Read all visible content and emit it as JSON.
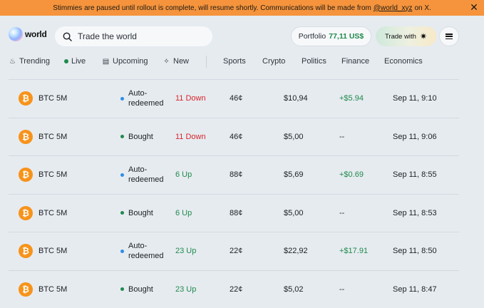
{
  "banner": {
    "message_before": "Stimmies are paused until rollout is complete, will resume shortly. Communications will be made from",
    "handle": "@world_xyz",
    "message_after": "on X.",
    "close_icon": "close-icon",
    "color": "#f5943d"
  },
  "header": {
    "logo_text": "world",
    "search": {
      "placeholder": "Trade the world",
      "value": ""
    },
    "portfolio": {
      "label": "Portfolio",
      "value": "77,11 US$"
    },
    "trade_with": {
      "label": "Trade with",
      "icon": "✷"
    },
    "menu_icon": "hamburger-menu-icon"
  },
  "nav": {
    "trending": "Trending",
    "live": "Live",
    "upcoming": "Upcoming",
    "new": "New",
    "sports": "Sports",
    "crypto": "Crypto",
    "politics": "Politics",
    "finance": "Finance",
    "economics": "Economics"
  },
  "colors": {
    "up": "#1f8a4c",
    "down": "#d7262b",
    "auto_redeemed_dot": "#2e8ee6",
    "bought_dot": "#1f8a4c",
    "btc": "#f7931a"
  },
  "rows": [
    {
      "icon": "bitcoin-icon",
      "symbol": "₿",
      "market": "BTC 5M",
      "status": "Auto-\nredeemed",
      "status_kind": "auto",
      "outcome": "11 Down",
      "direction": "down",
      "price": "46¢",
      "value": "$10,94",
      "pnl": "+$5.94",
      "time": "Sep 11, 9:10"
    },
    {
      "icon": "bitcoin-icon",
      "symbol": "₿",
      "market": "BTC 5M",
      "status": "Bought",
      "status_kind": "bought",
      "outcome": "11 Down",
      "direction": "down",
      "price": "46¢",
      "value": "$5,00",
      "pnl": "--",
      "time": "Sep 11, 9:06"
    },
    {
      "icon": "bitcoin-icon",
      "symbol": "₿",
      "market": "BTC 5M",
      "status": "Auto-\nredeemed",
      "status_kind": "auto",
      "outcome": "6 Up",
      "direction": "up",
      "price": "88¢",
      "value": "$5,69",
      "pnl": "+$0.69",
      "time": "Sep 11, 8:55"
    },
    {
      "icon": "bitcoin-icon",
      "symbol": "₿",
      "market": "BTC 5M",
      "status": "Bought",
      "status_kind": "bought",
      "outcome": "6 Up",
      "direction": "up",
      "price": "88¢",
      "value": "$5,00",
      "pnl": "--",
      "time": "Sep 11, 8:53"
    },
    {
      "icon": "bitcoin-icon",
      "symbol": "₿",
      "market": "BTC 5M",
      "status": "Auto-\nredeemed",
      "status_kind": "auto",
      "outcome": "23 Up",
      "direction": "up",
      "price": "22¢",
      "value": "$22,92",
      "pnl": "+$17.91",
      "time": "Sep 11, 8:50"
    },
    {
      "icon": "bitcoin-icon",
      "symbol": "₿",
      "market": "BTC 5M",
      "status": "Bought",
      "status_kind": "bought",
      "outcome": "23 Up",
      "direction": "up",
      "price": "22¢",
      "value": "$5,02",
      "pnl": "--",
      "time": "Sep 11, 8:47"
    }
  ]
}
